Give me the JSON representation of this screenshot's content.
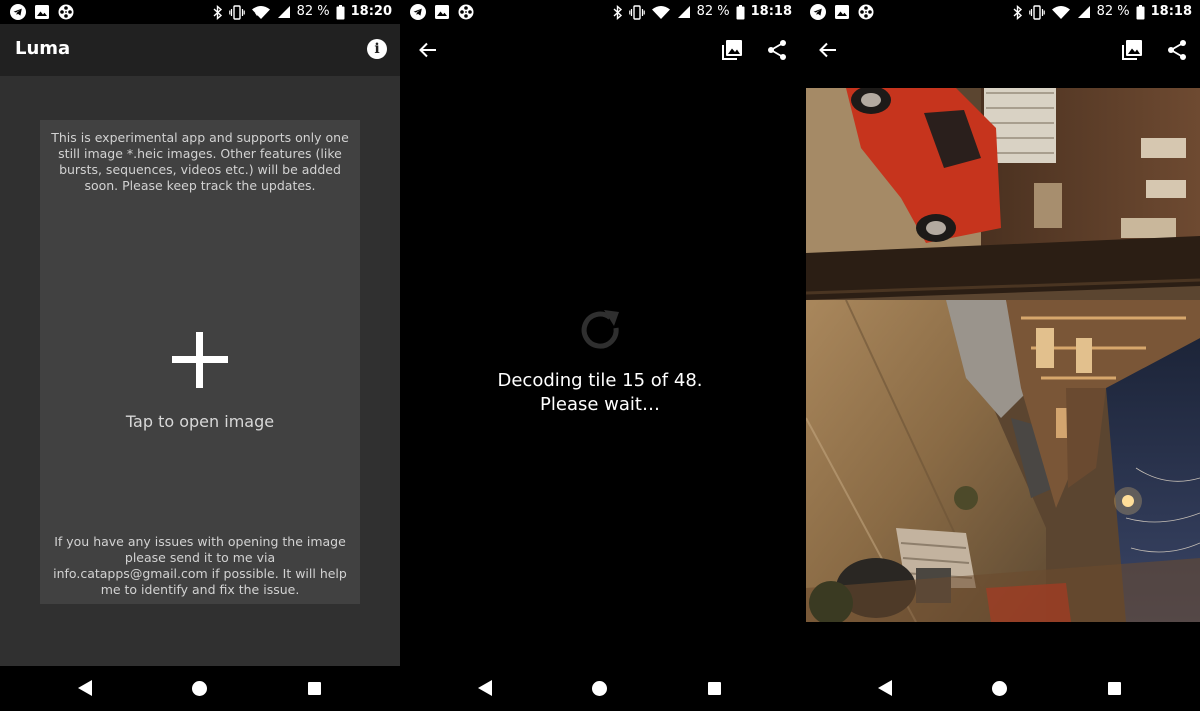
{
  "screens": [
    {
      "status": {
        "battery": "82 %",
        "time": "18:20"
      },
      "app_title": "Luma",
      "card": {
        "top_text": "This is experimental app and supports only one still image *.heic images. Other features (like bursts, sequences, videos etc.) will be added soon. Please keep track the updates.",
        "tap_label": "Tap to open image",
        "bottom_text": "If you have any issues with opening the image please send it to me via info.catapps@gmail.com if possible. It will help me to identify and fix the issue."
      }
    },
    {
      "status": {
        "battery": "82 %",
        "time": "18:18"
      },
      "loading": {
        "line1": "Decoding tile 15 of 48.",
        "line2": "Please wait…"
      }
    },
    {
      "status": {
        "battery": "82 %",
        "time": "18:18"
      }
    }
  ],
  "icons": {
    "status_left": [
      "telegram-icon",
      "image-icon",
      "film-reel-icon"
    ],
    "status_right": [
      "bluetooth-icon",
      "vibrate-icon",
      "wifi-icon",
      "signal-icon",
      "battery-icon"
    ],
    "toolbar": [
      "back-arrow-icon",
      "gallery-icon",
      "share-icon"
    ],
    "nav": [
      "nav-back-icon",
      "nav-home-icon",
      "nav-recents-icon"
    ]
  },
  "colors": {
    "app_background": "#303030",
    "app_bar": "#212121",
    "card": "#414141",
    "viewer_background": "#000000"
  }
}
